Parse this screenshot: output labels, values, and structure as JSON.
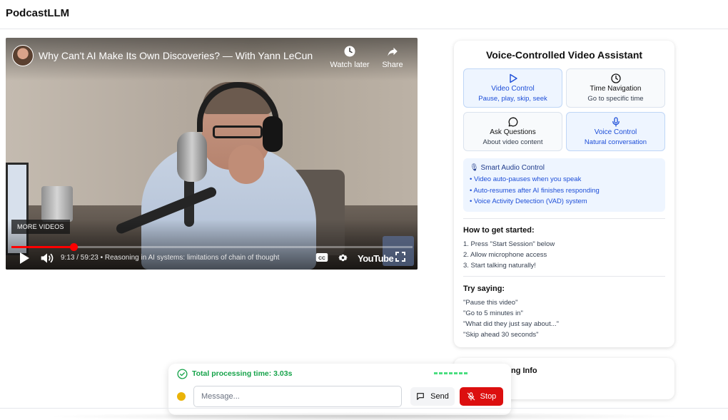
{
  "app": {
    "brand": "PodcastLLM"
  },
  "video": {
    "title": "Why Can't AI Make Its Own Discoveries? — With Yann LeCun",
    "watch_later": "Watch later",
    "share": "Share",
    "more_videos": "MORE VIDEOS",
    "time": "9:13 / 59:23",
    "chapter": "• Reasoning in AI systems: limitations of chain of thought",
    "progress_fraction": 0.155,
    "youtube_logo": "YouTube"
  },
  "assistant": {
    "title": "Voice-Controlled Video Assistant",
    "features": [
      {
        "title": "Video Control",
        "subtitle": "Pause, play, skip, seek",
        "icon": "play-icon",
        "active": true
      },
      {
        "title": "Time Navigation",
        "subtitle": "Go to specific time",
        "icon": "clock-icon",
        "active": false
      },
      {
        "title": "Ask Questions",
        "subtitle": "About video content",
        "icon": "chat-bubble-icon",
        "active": false
      },
      {
        "title": "Voice Control",
        "subtitle": "Natural conversation",
        "icon": "microphone-icon",
        "active": true
      }
    ],
    "smart_audio": {
      "title": "🎙 Smart Audio Control",
      "items": [
        "• Video auto-pauses when you speak",
        "• Auto-resumes after AI finishes responding",
        "• Voice Activity Detection (VAD) system"
      ]
    },
    "get_started": {
      "title": "How to get started:",
      "steps": [
        "1. Press \"Start Session\" below",
        "2. Allow microphone access",
        "3. Start talking naturally!"
      ]
    },
    "try_saying": {
      "title": "Try saying:",
      "examples": [
        "\"Pause this video\"",
        "\"Go to 5 minutes in\"",
        "\"What did they just say about...\"",
        "\"Skip ahead 30 seconds\""
      ]
    }
  },
  "second_card": {
    "title_fragment": "ng Info"
  },
  "chat": {
    "processing": "Total processing time: 3.03s",
    "placeholder": "Message...",
    "value": "",
    "send_label": "Send",
    "stop_label": "Stop"
  },
  "colors": {
    "accent_blue": "#1d4ed8",
    "success_green": "#16a34a",
    "stop_red": "#dc0f0f",
    "status_yellow": "#eab308",
    "youtube_red": "#ff0000"
  }
}
